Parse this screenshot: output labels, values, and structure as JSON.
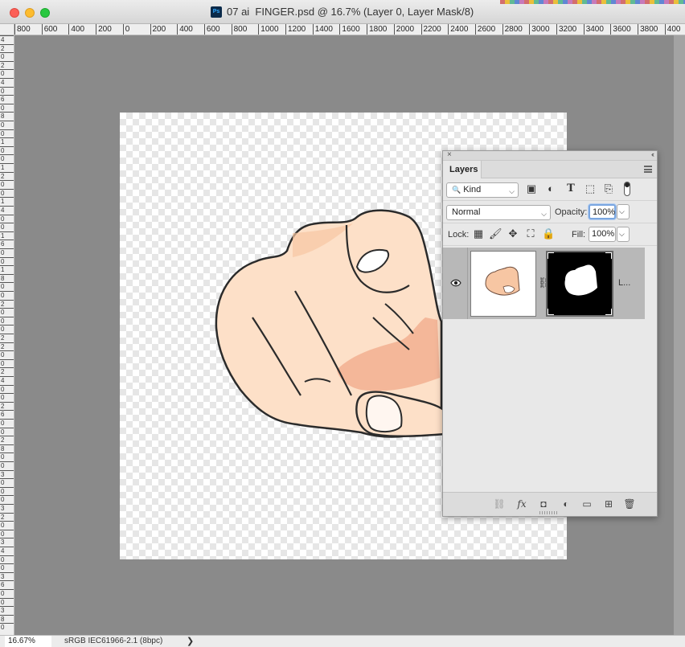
{
  "window": {
    "title": "07 ai  FINGER.psd @ 16.7% (Layer 0, Layer Mask/8)",
    "app_icon": "Ps"
  },
  "ruler_top": [
    "800",
    "600",
    "400",
    "200",
    "0",
    "200",
    "400",
    "600",
    "800",
    "1000",
    "1200",
    "1400",
    "1600",
    "1800",
    "2000",
    "2200",
    "2400",
    "2600",
    "2800",
    "3000",
    "3200",
    "3400",
    "3600",
    "3800",
    "400"
  ],
  "ruler_left": [
    "4",
    "2",
    "0",
    "2",
    "0",
    "4",
    "0",
    "6",
    "0",
    "8",
    "0",
    "0",
    "1",
    "0",
    "0",
    "1",
    "2",
    "0",
    "0",
    "1",
    "4",
    "0",
    "0",
    "1",
    "6",
    "0",
    "0",
    "1",
    "8",
    "0",
    "0",
    "2",
    "0",
    "0",
    "0",
    "2",
    "2",
    "0",
    "0",
    "2",
    "4",
    "0",
    "0",
    "2",
    "6",
    "0",
    "0",
    "2",
    "8",
    "0",
    "0",
    "3",
    "0",
    "0",
    "0",
    "3",
    "2",
    "0",
    "0",
    "3",
    "4",
    "0",
    "0",
    "3",
    "6",
    "0",
    "0",
    "3",
    "8",
    "0"
  ],
  "status": {
    "zoom": "16.67%",
    "profile": "sRGB IEC61966-2.1 (8bpc)",
    "arrow": "❯"
  },
  "layers_panel": {
    "close_glyph": "×",
    "collapse_glyph": "‹‹",
    "tab_label": "Layers",
    "filter": {
      "search_glyph": "🔍",
      "value": "Kind",
      "caret": "⌵"
    },
    "blend_mode": {
      "value": "Normal",
      "caret": "⌵"
    },
    "opacity": {
      "label": "Opacity:",
      "value": "100%",
      "caret": "⌵"
    },
    "lock_label": "Lock:",
    "fill": {
      "label": "Fill:",
      "value": "100%",
      "caret": "⌵"
    },
    "filter_icons": [
      "▣",
      "◐",
      "T",
      "⬚",
      "⎘"
    ],
    "lock_icons": [
      "▦",
      "🖌",
      "✥",
      "⛶",
      "🔒"
    ],
    "layer": {
      "name": "L...",
      "chain_glyph": "⛓"
    },
    "bottom_icons": [
      "⛓",
      "fx",
      "◘",
      "◐",
      "▭",
      "⊞",
      "🗑"
    ]
  },
  "colors": {
    "skin_light": "#fde0c8",
    "skin_mid": "#f7c6a3",
    "skin_shadow": "#f0a98a",
    "outline": "#2b2b2b",
    "canvas_bg": "#8a8a8a"
  }
}
